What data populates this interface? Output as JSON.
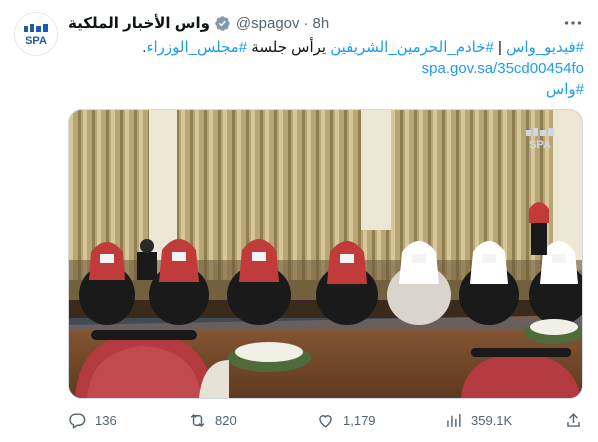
{
  "account": {
    "display_name": "واس الأخبار الملكية",
    "handle": "@spagov",
    "separator": "·",
    "time": "8h",
    "avatar_text": "SPA"
  },
  "tweet": {
    "line1_hashtag_video": "#فيديو_واس",
    "line1_separator": " | ",
    "line1_hashtag_king": "#خادم_الحرمين_الشريفين",
    "line1_text": " يرأس جلسة ",
    "line1_hashtag_council": "#مجلس_الوزراء",
    "line1_end": ".",
    "link": "spa.gov.sa/35cd00454fo",
    "hashtag_was": "#واس"
  },
  "media": {
    "watermark": "SPA"
  },
  "actions": {
    "replies": "136",
    "retweets": "820",
    "likes": "1,179",
    "views": "359.1K"
  },
  "icons": {
    "verified": "verified-badge-icon",
    "more": "more-options-icon",
    "reply": "reply-icon",
    "retweet": "retweet-icon",
    "like": "like-icon",
    "views": "views-icon",
    "share": "share-icon"
  },
  "colors": {
    "link": "#1d9bf0",
    "text": "#0f1419",
    "muted": "#536471",
    "verified": "#829aab",
    "logo": "#1f5aa8"
  }
}
